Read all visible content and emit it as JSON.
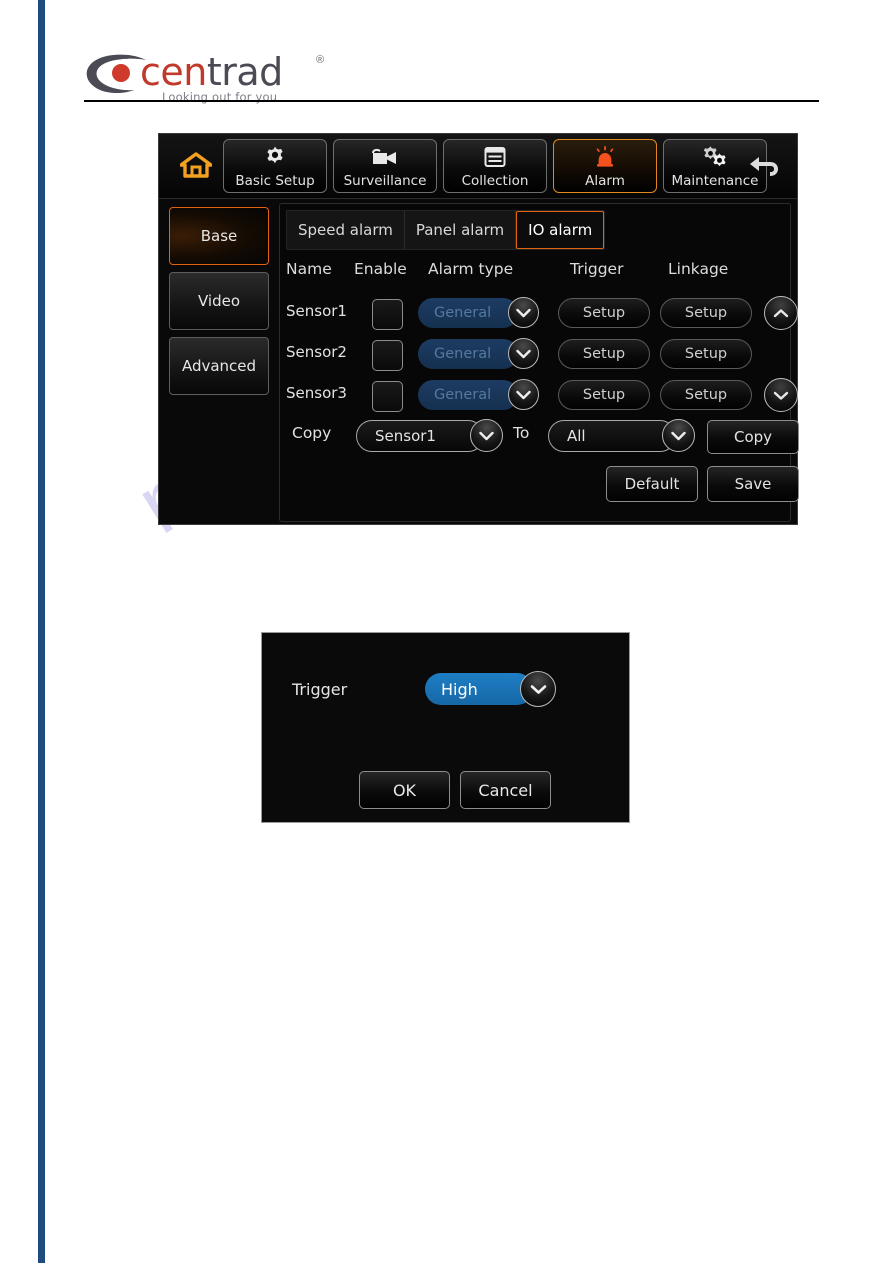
{
  "brand": {
    "name_part1": "cen",
    "name_part2": "trad",
    "registered": "®",
    "tagline": "Looking out for you"
  },
  "watermark": {
    "text": "manualshive.com"
  },
  "device": {
    "nav": {
      "home_icon": "home-icon",
      "back_icon": "back-arrow-icon",
      "tabs": [
        {
          "label": "Basic Setup",
          "icon": "gear-icon",
          "active": false
        },
        {
          "label": "Surveillance",
          "icon": "camcorder-icon",
          "active": false
        },
        {
          "label": "Collection",
          "icon": "window-list-icon",
          "active": false
        },
        {
          "label": "Alarm",
          "icon": "siren-icon",
          "active": true
        },
        {
          "label": "Maintenance",
          "icon": "double-gear-icon",
          "active": false
        }
      ]
    },
    "sidebar": {
      "items": [
        {
          "label": "Base",
          "active": true
        },
        {
          "label": "Video",
          "active": false
        },
        {
          "label": "Advanced",
          "active": false
        }
      ]
    },
    "sub_tabs": [
      {
        "label": "Speed alarm",
        "active": false
      },
      {
        "label": "Panel alarm",
        "active": false
      },
      {
        "label": "IO alarm",
        "active": true
      }
    ],
    "table": {
      "columns": [
        "Name",
        "Enable",
        "Alarm type",
        "Trigger",
        "Linkage"
      ],
      "rows": [
        {
          "name": "Sensor1",
          "enabled": false,
          "alarm_type": "General",
          "trigger_button": "Setup",
          "linkage_button": "Setup"
        },
        {
          "name": "Sensor2",
          "enabled": false,
          "alarm_type": "General",
          "trigger_button": "Setup",
          "linkage_button": "Setup"
        },
        {
          "name": "Sensor3",
          "enabled": false,
          "alarm_type": "General",
          "trigger_button": "Setup",
          "linkage_button": "Setup"
        }
      ],
      "scroll_up_icon": "chevron-up-icon",
      "scroll_down_icon": "chevron-down-icon"
    },
    "copy_row": {
      "copy_label": "Copy",
      "source_value": "Sensor1",
      "to_label": "To",
      "target_value": "All",
      "copy_button": "Copy"
    },
    "actions": {
      "default_button": "Default",
      "save_button": "Save"
    },
    "colors": {
      "accent_orange": "#e2620f",
      "select_blue": "#1d3c63",
      "panel_black": "#090909"
    }
  },
  "dialog": {
    "trigger_label": "Trigger",
    "trigger_value": "High",
    "ok_button": "OK",
    "cancel_button": "Cancel",
    "highlight_blue": "#1e7ec4"
  }
}
